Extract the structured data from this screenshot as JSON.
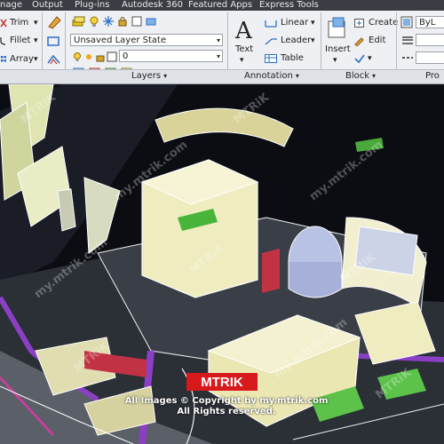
{
  "menu_tabs": [
    "nage",
    "Output",
    "Plug-ins",
    "Autodesk 360",
    "Featured Apps",
    "Express Tools"
  ],
  "modify": {
    "trim": "Trim",
    "fillet": "Fillet",
    "array": "Array"
  },
  "layers": {
    "state_value": "Unsaved Layer State",
    "layer_value": "0",
    "panel_title": "Layers"
  },
  "annotation": {
    "text": "Text",
    "linear": "Linear",
    "leader": "Leader",
    "table": "Table",
    "panel_title": "Annotation"
  },
  "block": {
    "insert": "Insert",
    "create": "Create",
    "edit": "Edit",
    "panel_title": "Block"
  },
  "properties": {
    "bylayer": "ByL",
    "panel_title": "Pro"
  },
  "watermark": {
    "brand": "MTRIK",
    "copyright_line1": "All Images © Copyright by my.mtrik.com",
    "copyright_line2": "All Rights reserved.",
    "tiles": [
      "MTRiK",
      "my.mtrik.com"
    ]
  },
  "colors": {
    "accent": "#2f6fc6",
    "brand_red": "#d7191c",
    "drawing_bg": "#0b0d12"
  }
}
